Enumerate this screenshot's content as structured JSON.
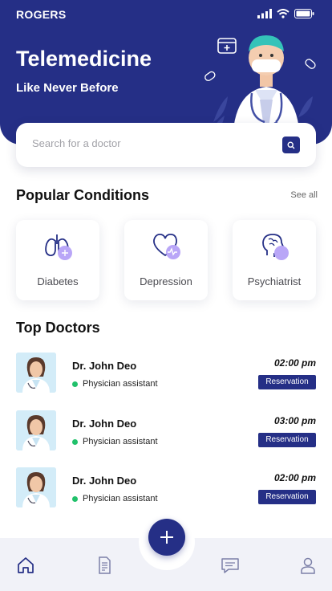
{
  "status_bar": {
    "carrier": "ROGERS"
  },
  "hero": {
    "title": "Telemedicine",
    "subtitle": "Like Never Before"
  },
  "search": {
    "placeholder": "Search for a doctor"
  },
  "popular": {
    "title": "Popular Conditions",
    "see_all": "See all",
    "items": [
      {
        "label": "Diabetes",
        "icon": "lungs-icon"
      },
      {
        "label": "Depression",
        "icon": "heart-pulse-icon"
      },
      {
        "label": "Psychiatrist",
        "icon": "brain-icon"
      }
    ]
  },
  "top_doctors": {
    "title": "Top Doctors",
    "items": [
      {
        "name": "Dr. John Deo",
        "role": "Physician assistant",
        "time": "02:00 pm",
        "action": "Reservation"
      },
      {
        "name": "Dr. John Deo",
        "role": "Physician assistant",
        "time": "03:00 pm",
        "action": "Reservation"
      },
      {
        "name": "Dr. John Deo",
        "role": "Physician assistant",
        "time": "02:00 pm",
        "action": "Reservation"
      }
    ]
  },
  "bottom_nav": {
    "items": [
      "home-icon",
      "document-icon",
      "add-icon",
      "chat-icon",
      "profile-icon"
    ]
  },
  "colors": {
    "primary": "#252f86",
    "accent": "#b9a6f7",
    "online": "#21c16b"
  }
}
